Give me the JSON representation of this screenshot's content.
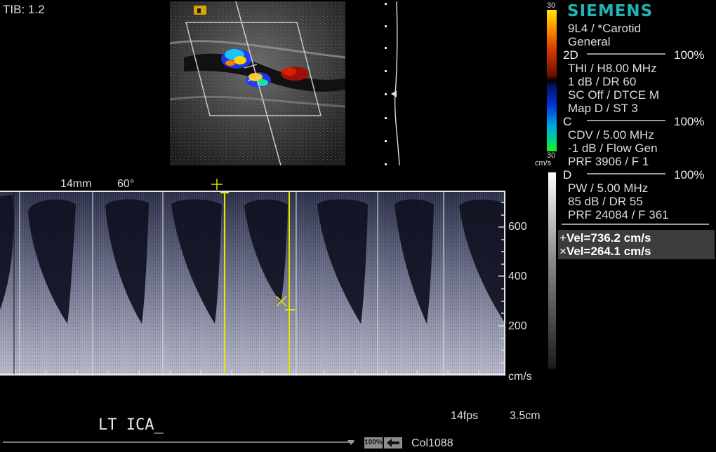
{
  "top_left": {
    "tib": "TIB: 1.2"
  },
  "color_bar": {
    "top_value": "30",
    "bottom_value": "30",
    "unit": "cm/s"
  },
  "panel": {
    "logo": "SIEMENS",
    "probe": "9L4 / *Carotid",
    "preset": "General",
    "sections": [
      {
        "letter": "2D",
        "percent": "100%",
        "lines": [
          "THI / H8.00 MHz",
          "1 dB / DR 60",
          "SC Off / DTCE M",
          "Map D / ST 3"
        ]
      },
      {
        "letter": "C",
        "percent": "100%",
        "lines": [
          "CDV / 5.00 MHz",
          "-1 dB / Flow Gen",
          "PRF 3906 / F 1"
        ]
      },
      {
        "letter": "D",
        "percent": "100%",
        "lines": [
          "PW / 5.00 MHz",
          "85 dB / DR 55",
          "PRF 24084 / F 361"
        ]
      }
    ],
    "measurements": [
      {
        "marker": "+",
        "label": "Vel=736.2 cm/s"
      },
      {
        "marker": "×",
        "label": "Vel=264.1 cm/s"
      }
    ]
  },
  "doppler": {
    "gate_size": "14mm",
    "angle": "60°",
    "y_ticks": [
      "600",
      "400",
      "200"
    ],
    "y_unit": "cm/s"
  },
  "footer": {
    "annotation": "LT ICA_",
    "fps": "14fps",
    "depth": "3.5cm",
    "zoom_badge": "100%",
    "col": "Col1088"
  },
  "colors": {
    "logo": "#1fb4b4",
    "caliper": "#e6e600",
    "velocity_box": "#3c3c3c"
  },
  "icons": [
    "probe-orientation-marker-icon",
    "caliper-plus-icon",
    "caliper-x-icon",
    "back-arrow-icon",
    "down-triangle-icon"
  ]
}
